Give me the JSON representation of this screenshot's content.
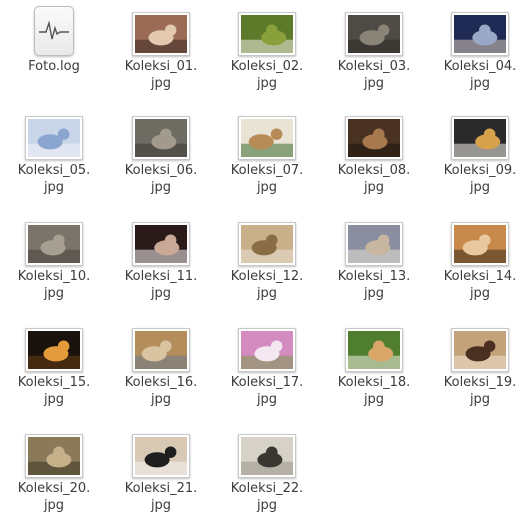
{
  "files": [
    {
      "name": "Foto.log",
      "kind": "log",
      "icon": "text-log-icon"
    },
    {
      "name_line1": "Koleksi_01.",
      "name_line2": "jpg",
      "kind": "image",
      "colors": [
        "#9b6b55",
        "#e4c9b1",
        "#3a2a22"
      ]
    },
    {
      "name_line1": "Koleksi_02.",
      "name_line2": "jpg",
      "kind": "image",
      "colors": [
        "#5d7a2a",
        "#8aa03a",
        "#f0ece6"
      ]
    },
    {
      "name_line1": "Koleksi_03.",
      "name_line2": "jpg",
      "kind": "image",
      "colors": [
        "#4e4b46",
        "#8a8478",
        "#2b2925"
      ]
    },
    {
      "name_line1": "Koleksi_04.",
      "name_line2": "jpg",
      "kind": "image",
      "colors": [
        "#1f2a55",
        "#9aa8c8",
        "#d9cbb8"
      ]
    },
    {
      "name_line1": "Koleksi_05.",
      "name_line2": "jpg",
      "kind": "image",
      "colors": [
        "#c9d6ea",
        "#8aa5cf",
        "#f4f4f8"
      ]
    },
    {
      "name_line1": "Koleksi_06.",
      "name_line2": "jpg",
      "kind": "image",
      "colors": [
        "#6e6b63",
        "#a29a8c",
        "#3d3a35"
      ]
    },
    {
      "name_line1": "Koleksi_07.",
      "name_line2": "jpg",
      "kind": "image",
      "colors": [
        "#e9e3d6",
        "#b78b55",
        "#3c6b2e"
      ]
    },
    {
      "name_line1": "Koleksi_08.",
      "name_line2": "jpg",
      "kind": "image",
      "colors": [
        "#4a3223",
        "#a8794e",
        "#1d1510"
      ]
    },
    {
      "name_line1": "Koleksi_09.",
      "name_line2": "jpg",
      "kind": "image",
      "colors": [
        "#2a2a2a",
        "#d8a24c",
        "#f1ede5"
      ]
    },
    {
      "name_line1": "Koleksi_10.",
      "name_line2": "jpg",
      "kind": "image",
      "colors": [
        "#7b746a",
        "#a79f92",
        "#4a443d"
      ]
    },
    {
      "name_line1": "Koleksi_11.",
      "name_line2": "jpg",
      "kind": "image",
      "colors": [
        "#2b1a1a",
        "#c9a896",
        "#f2f0ee"
      ]
    },
    {
      "name_line1": "Koleksi_12.",
      "name_line2": "jpg",
      "kind": "image",
      "colors": [
        "#c9b08a",
        "#8a6c45",
        "#e9e1d3"
      ]
    },
    {
      "name_line1": "Koleksi_13.",
      "name_line2": "jpg",
      "kind": "image",
      "colors": [
        "#8b8ea0",
        "#c9b6a1",
        "#e7e1d8"
      ]
    },
    {
      "name_line1": "Koleksi_14.",
      "name_line2": "jpg",
      "kind": "image",
      "colors": [
        "#c88a4a",
        "#e8c89e",
        "#3b2b1f"
      ]
    },
    {
      "name_line1": "Koleksi_15.",
      "name_line2": "jpg",
      "kind": "image",
      "colors": [
        "#1a120c",
        "#e39a3a",
        "#6a3d16"
      ]
    },
    {
      "name_line1": "Koleksi_16.",
      "name_line2": "jpg",
      "kind": "image",
      "colors": [
        "#b38e5c",
        "#d9c3a0",
        "#6a7a8a"
      ]
    },
    {
      "name_line1": "Koleksi_17.",
      "name_line2": "jpg",
      "kind": "image",
      "colors": [
        "#d38bc0",
        "#f3e8ef",
        "#7b9a4e"
      ]
    },
    {
      "name_line1": "Koleksi_18.",
      "name_line2": "jpg",
      "kind": "image",
      "colors": [
        "#4f7f2e",
        "#d9a66a",
        "#f3ece1"
      ]
    },
    {
      "name_line1": "Koleksi_19.",
      "name_line2": "jpg",
      "kind": "image",
      "colors": [
        "#c4a27a",
        "#4a3020",
        "#efe3d0"
      ]
    },
    {
      "name_line1": "Koleksi_20.",
      "name_line2": "jpg",
      "kind": "image",
      "colors": [
        "#8a7a5a",
        "#c6b08a",
        "#3d3424"
      ]
    },
    {
      "name_line1": "Koleksi_21.",
      "name_line2": "jpg",
      "kind": "image",
      "colors": [
        "#d8c9b5",
        "#1e1e1e",
        "#f4f4f4"
      ]
    },
    {
      "name_line1": "Koleksi_22.",
      "name_line2": "jpg",
      "kind": "image",
      "colors": [
        "#d6d2c8",
        "#3a3632",
        "#9c968a"
      ]
    }
  ]
}
